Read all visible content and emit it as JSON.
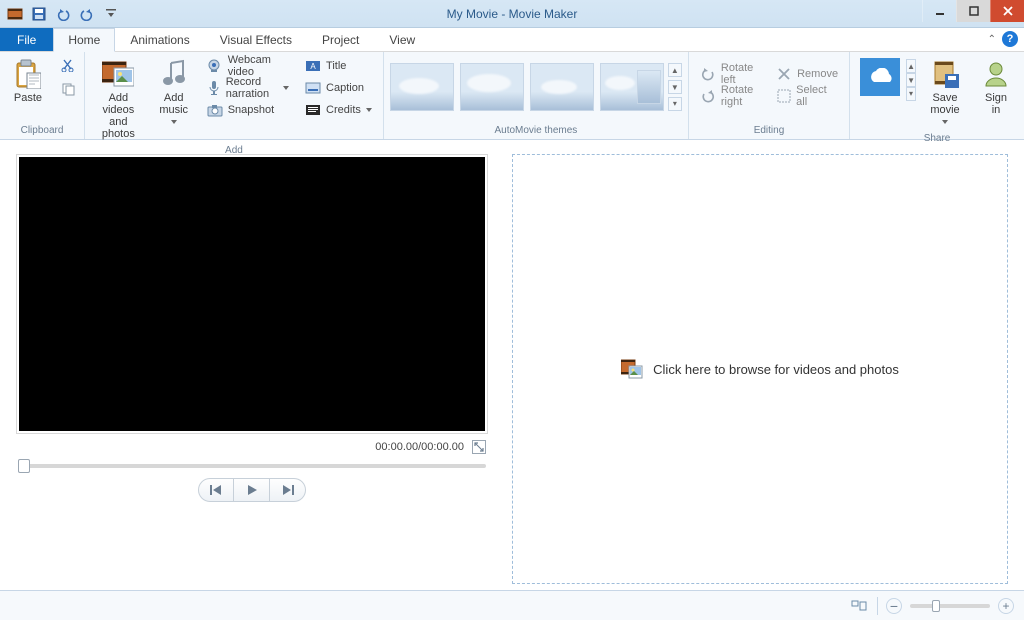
{
  "window": {
    "title": "My Movie - Movie Maker"
  },
  "qat": {
    "undo": "undo",
    "redo": "redo",
    "save": "save"
  },
  "tabs": {
    "file": "File",
    "items": [
      "Home",
      "Animations",
      "Visual Effects",
      "Project",
      "View"
    ],
    "active": "Home"
  },
  "ribbon": {
    "clipboard": {
      "label": "Clipboard",
      "paste": "Paste",
      "cut": "Cut",
      "copy": "Copy"
    },
    "add": {
      "label": "Add",
      "add_media": "Add videos\nand photos",
      "add_music": "Add\nmusic",
      "webcam": "Webcam video",
      "narration": "Record narration",
      "snapshot": "Snapshot",
      "title": "Title",
      "caption": "Caption",
      "credits": "Credits"
    },
    "automovie": {
      "label": "AutoMovie themes"
    },
    "editing": {
      "label": "Editing",
      "rotate_left": "Rotate left",
      "rotate_right": "Rotate right",
      "remove": "Remove",
      "select_all": "Select all"
    },
    "share": {
      "label": "Share",
      "save_movie": "Save\nmovie",
      "sign_in": "Sign\nin"
    }
  },
  "preview": {
    "timecode": "00:00.00/00:00.00"
  },
  "storyboard": {
    "placeholder": "Click here to browse for videos and photos"
  },
  "status": {
    "zoom_out": "−",
    "zoom_in": "+"
  }
}
